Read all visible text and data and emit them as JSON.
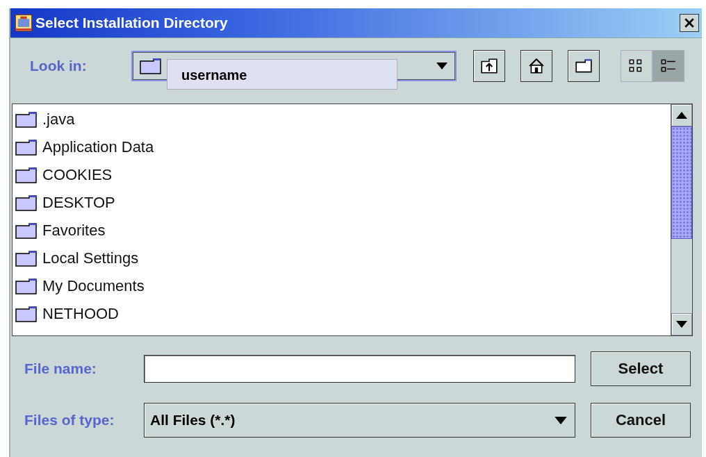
{
  "window": {
    "title": "Select Installation Directory"
  },
  "look_in": {
    "label": "Look in:",
    "value": "username"
  },
  "toolbar": [
    {
      "kind": "up",
      "selected": false
    },
    {
      "kind": "home",
      "selected": false
    },
    {
      "kind": "newfolder",
      "selected": false
    },
    {
      "kind": "list",
      "selected": false
    },
    {
      "kind": "details",
      "selected": true
    }
  ],
  "files": [
    {
      "name": ".java"
    },
    {
      "name": "Application Data"
    },
    {
      "name": "COOKIES"
    },
    {
      "name": "DESKTOP"
    },
    {
      "name": "Favorites"
    },
    {
      "name": "Local Settings"
    },
    {
      "name": "My Documents"
    },
    {
      "name": "NETHOOD"
    }
  ],
  "file_name": {
    "label": "File name:"
  },
  "files_of_type": {
    "label": "Files of type:",
    "value": "All Files (*.*)"
  },
  "buttons": [
    "Select",
    "Cancel"
  ]
}
